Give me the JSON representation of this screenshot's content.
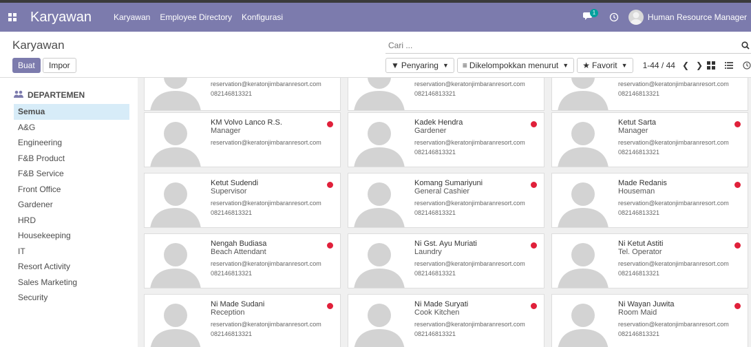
{
  "topbar": {
    "app_title": "Karyawan",
    "nav": [
      "Karyawan",
      "Employee Directory",
      "Konfigurasi"
    ],
    "chat_badge": "1",
    "user_name": "Human Resource Manager"
  },
  "control": {
    "breadcrumb": "Karyawan",
    "create_label": "Buat",
    "import_label": "Impor",
    "search_placeholder": "Cari ...",
    "filter_label": "Penyaring",
    "group_label": "Dikelompokkan menurut",
    "favorite_label": "Favorit",
    "pager": "1-44 / 44"
  },
  "sidebar": {
    "header": "DEPARTEMEN",
    "items": [
      "Semua",
      "A&G",
      "Engineering",
      "F&B Product",
      "F&B Service",
      "Front Office",
      "Gardener",
      "HRD",
      "Housekeeping",
      "IT",
      "Resort Activity",
      "Sales Marketing",
      "Security"
    ],
    "active_index": 0
  },
  "cards": [
    {
      "name": "",
      "job": "",
      "email": "reservation@keratonjimbaranresort.com",
      "phone": "082146813321",
      "status_color": ""
    },
    {
      "name": "",
      "job": "",
      "email": "reservation@keratonjimbaranresort.com",
      "phone": "082146813321",
      "status_color": ""
    },
    {
      "name": "",
      "job": "",
      "email": "reservation@keratonjimbaranresort.com",
      "phone": "082146813321",
      "status_color": ""
    },
    {
      "name": "KM Volvo Lanco R.S.",
      "job": "Manager",
      "email": "reservation@keratonjimbaranresort.com",
      "phone": "",
      "status_color": "#e0203a"
    },
    {
      "name": "Kadek Hendra",
      "job": "Gardener",
      "email": "reservation@keratonjimbaranresort.com",
      "phone": "082146813321",
      "status_color": "#e0203a"
    },
    {
      "name": "Ketut Sarta",
      "job": "Manager",
      "email": "reservation@keratonjimbaranresort.com",
      "phone": "082146813321",
      "status_color": "#e0203a"
    },
    {
      "name": "Ketut Sudendi",
      "job": "Supervisor",
      "email": "reservation@keratonjimbaranresort.com",
      "phone": "082146813321",
      "status_color": "#e0203a"
    },
    {
      "name": "Komang Sumariyuni",
      "job": "General Cashier",
      "email": "reservation@keratonjimbaranresort.com",
      "phone": "082146813321",
      "status_color": "#e0203a"
    },
    {
      "name": "Made Redanis",
      "job": "Houseman",
      "email": "reservation@keratonjimbaranresort.com",
      "phone": "082146813321",
      "status_color": "#e0203a"
    },
    {
      "name": "Nengah Budiasa",
      "job": "Beach Attendant",
      "email": "reservation@keratonjimbaranresort.com",
      "phone": "082146813321",
      "status_color": "#e0203a"
    },
    {
      "name": "Ni Gst. Ayu Muriati",
      "job": "Laundry",
      "email": "reservation@keratonjimbaranresort.com",
      "phone": "082146813321",
      "status_color": "#e0203a"
    },
    {
      "name": "Ni Ketut Astiti",
      "job": "Tel. Operator",
      "email": "reservation@keratonjimbaranresort.com",
      "phone": "082146813321",
      "status_color": "#e0203a"
    },
    {
      "name": "Ni Made Sudani",
      "job": "Reception",
      "email": "reservation@keratonjimbaranresort.com",
      "phone": "082146813321",
      "status_color": "#e0203a"
    },
    {
      "name": "Ni Made Suryati",
      "job": "Cook Kitchen",
      "email": "reservation@keratonjimbaranresort.com",
      "phone": "082146813321",
      "status_color": "#e0203a"
    },
    {
      "name": "Ni Wayan Juwita",
      "job": "Room Maid",
      "email": "reservation@keratonjimbaranresort.com",
      "phone": "082146813321",
      "status_color": "#e0203a"
    }
  ],
  "colors": {
    "brand": "#7c7bad",
    "active_item": "#d7ecf8",
    "status_red": "#e0203a"
  }
}
